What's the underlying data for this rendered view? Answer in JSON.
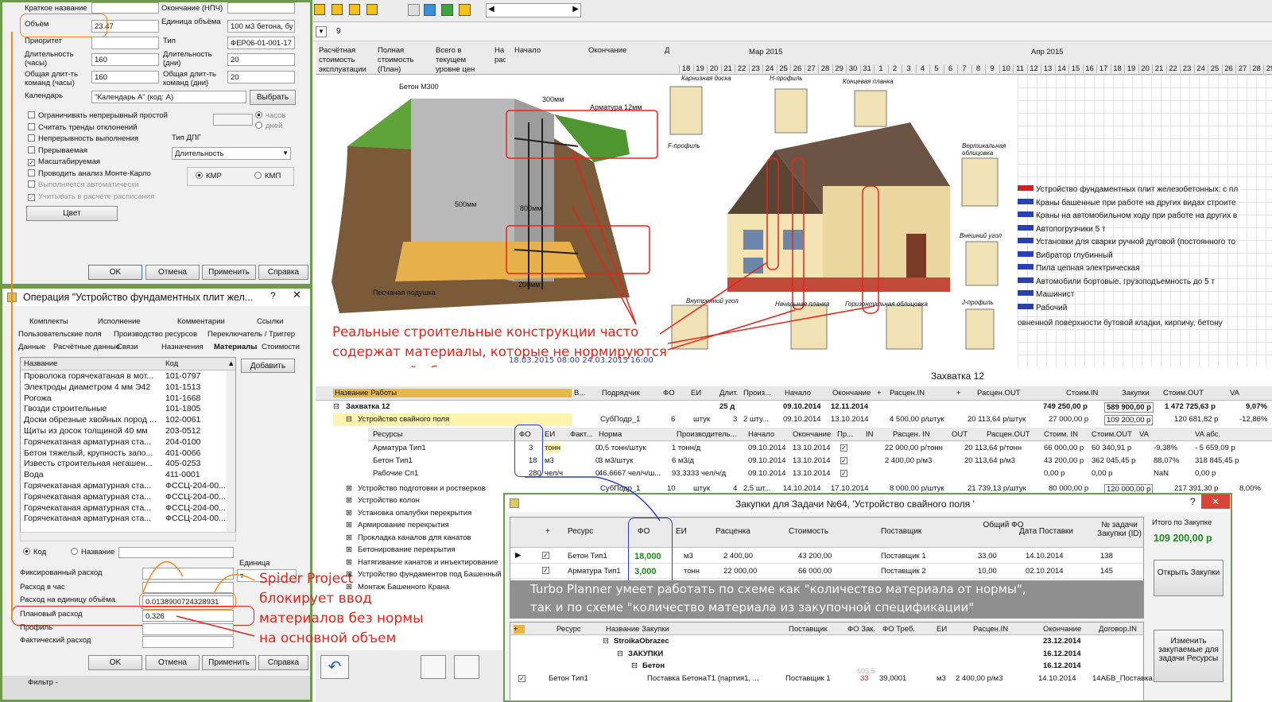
{
  "toolbar": {
    "zoom_text": "9"
  },
  "props_dialog": {
    "fields": {
      "short_name_label": "Краткое название",
      "end_label": "Окончание (НПЧ)",
      "volume_label": "Объём",
      "volume_value": "23.47",
      "unit_label": "Единица объёма",
      "unit_value": "100 м3 бетона, бу",
      "priority_label": "Приоритет",
      "type_label": "Тип",
      "type_value": "ФЕР06-01-001-17",
      "duration_label": "Длительность (часы)",
      "duration_value": "160",
      "duration_days_label": "Длительность (дни)",
      "duration_days_value": "20",
      "total_team_hours_label": "Общая длит-ть команд (часы)",
      "total_team_hours_value": "160",
      "total_team_days_label": "Общая длит-ть команд (дни)",
      "total_team_days_value": "20",
      "calendar_label": "Календарь",
      "calendar_value": "\"Календарь А\" (код: А)",
      "choose_button": "Выбрать",
      "hours_radio": "часов",
      "days_radio": "дней",
      "dpg_type_label": "Тип ДПГ",
      "dpg_type_value": "Длительность",
      "kmr": "КМР",
      "kmp": "КМП",
      "color_button": "Цвет"
    },
    "checks": [
      {
        "label": "Ограничивать непрерывный простой",
        "checked": false
      },
      {
        "label": "Считать тренды отклонений",
        "checked": false
      },
      {
        "label": "Непрерывность выполнения",
        "checked": false
      },
      {
        "label": "Прерываемая",
        "checked": false
      },
      {
        "label": "Масштабируемая",
        "checked": true
      },
      {
        "label": "Проводить анализ Монте-Карло",
        "checked": false
      },
      {
        "label": "Выполняется автоматически",
        "checked": false
      },
      {
        "label": "Учитывать в расчёте расписания",
        "checked": true
      }
    ],
    "buttons": {
      "ok": "OK",
      "cancel": "Отмена",
      "apply": "Применить",
      "help": "Справка"
    }
  },
  "op_dialog": {
    "title": "Операция \"Устройство фундаментных плит жел...",
    "tabs_row1": [
      "Комплекты",
      "Исполнение",
      "Комментарии",
      "Ссылки"
    ],
    "tabs_row2": [
      "Пользовательские поля",
      "Производство ресурсов",
      "Переключатель / Триггер"
    ],
    "tabs_row3": [
      "Данные",
      "Расчётные данные",
      "Связи",
      "Назначения",
      "Материалы",
      "Стоимости"
    ],
    "col_name": "Название",
    "col_code": "Код",
    "add_button": "Добавить",
    "materials": [
      {
        "name": "Проволока горячекатаная в мот...",
        "code": "101-0797"
      },
      {
        "name": "Электроды диаметром 4 мм Э42",
        "code": "101-1513"
      },
      {
        "name": "Рогожа",
        "code": "101-1668"
      },
      {
        "name": "Гвозди строительные",
        "code": "101-1805"
      },
      {
        "name": "Доски обрезные хвойных пород ...",
        "code": "102-0061"
      },
      {
        "name": "Щиты из досок толщиной 40 мм",
        "code": "203-0512"
      },
      {
        "name": "Горячекатаная арматурная ста...",
        "code": "204-0100"
      },
      {
        "name": "Бетон тяжелый, крупность запо...",
        "code": "401-0066"
      },
      {
        "name": "Известь строительная негашен...",
        "code": "405-0253"
      },
      {
        "name": "Вода",
        "code": "411-0001"
      },
      {
        "name": "Горячекатаная арматурная ста...",
        "code": "ФССЦ-204-00..."
      },
      {
        "name": "Горячекатаная арматурная ста...",
        "code": "ФССЦ-204-00..."
      },
      {
        "name": "Горячекатаная арматурная ста...",
        "code": "ФССЦ-204-00..."
      },
      {
        "name": "Горячекатаная арматурная ста...",
        "code": "ФССЦ-204-00..."
      }
    ],
    "radio_code": "Код",
    "radio_name": "Название",
    "unit_label": "Единица",
    "unit_value": "т",
    "fixed_label": "Фиксированный расход",
    "hourly_label": "Расход в час",
    "per_unit_label": "Расход на единицу объёма",
    "per_unit_value": "0.0138900724328931",
    "plan_label": "Плановый расход",
    "plan_value": "0.326",
    "profile_label": "Профиль",
    "actual_label": "Фактический расход",
    "buttons": {
      "ok": "OK",
      "cancel": "Отмена",
      "apply": "Применить",
      "help": "Справка"
    },
    "filter_label": "Фильтр -"
  },
  "gantt": {
    "cols": [
      "Расчётная стоимость эксплуатации",
      "Полная стоимость (План)",
      "Всего в текущем уровне цен",
      "На рас",
      "Начало",
      "Окончание",
      "Д"
    ],
    "month1": "Мар 2015",
    "month2": "Апр 2015",
    "days_mar": [
      "18",
      "19",
      "20",
      "21",
      "22",
      "23",
      "24",
      "25",
      "26",
      "27",
      "28",
      "29",
      "30",
      "31"
    ],
    "days_apr": [
      "1",
      "2",
      "3",
      "4",
      "5",
      "6",
      "7",
      "8",
      "9",
      "10",
      "11",
      "12",
      "13",
      "14",
      "15",
      "16",
      "17",
      "18",
      "19",
      "20",
      "21",
      "22",
      "23",
      "24",
      "25",
      "26",
      "27",
      "28",
      "29",
      "30"
    ],
    "resources": [
      "Устройство фундаментных плит железобетонных: с пл",
      "Краны башенные при работе на других видах строите",
      "Краны на автомобильном ходу при работе на других в",
      "Автопогрузчики 5 т",
      "Установки для сварки ручной дуговой (постоянного то",
      "Вибратор глубинный",
      "Пила цепная электрическая",
      "Автомобили бортовые, грузоподъемность до 5 т",
      "Машинист",
      "Рабочий"
    ],
    "res_tail": "овненной поверхности бутовой кладки, кирпичу, бетону",
    "date_fragment": "18.03.2015 08:00   24.03.2015 16:00"
  },
  "illustration": {
    "beton": "Бетон М300",
    "armatura": "Арматура 12мм",
    "d300": "300мм",
    "d500": "500мм",
    "d800": "800мм",
    "d200": "200мм",
    "sand": "Песчаная подушка",
    "karniz": "Карнизная доска",
    "hprof": "Н-профиль",
    "konc": "Концевая планка",
    "fprof": "F-профиль",
    "vert": "Вертикальная облицовка",
    "vnesh": "Внешний угол",
    "vnutr": "Внутренний угол",
    "nach": "Начальная планка",
    "gor": "Горизонтальная облицовка",
    "jprof": "J-профиль"
  },
  "annotations": {
    "top": [
      "Реальные строительные конструкции часто",
      "содержат материалы, которые не нормируются",
      "на основной объем операции"
    ],
    "left": [
      "Spider Project",
      "блокирует ввод",
      "материалов без нормы",
      "на основной объем"
    ],
    "bottom": [
      "Turbo Planner умеет работать по схеме как \"количество материала от нормы\",",
      "так и по схеме \"количество материала из закупочной спецификации\""
    ]
  },
  "works": {
    "title": "Захватка 12",
    "headers": [
      "Название Работы",
      "В...",
      "Подрядчик",
      "ФО",
      "ЕИ",
      "Длит.",
      "Произ...",
      "Начало",
      "Окончание",
      "+",
      "Расцен.IN",
      "+",
      "Расцен.OUT",
      "Стоим.IN",
      "Закупки",
      "Стоим.OUT",
      "VA"
    ],
    "group_row": {
      "name": "Захватка 12",
      "dur": "25 д",
      "start": "09.10.2014",
      "end": "12.11.2014",
      "cost_in": "749 250,00 р",
      "purch": "589 900,00 р",
      "cost_out": "1 472 725,63 р",
      "va": "9,07%"
    },
    "task_row": {
      "name": "Устройство свайного поля",
      "contractor": "СубПодр_1",
      "fo": "6",
      "unit": "штук",
      "dur": "3",
      "prod": "2 шту...",
      "start": "09.10.2014",
      "end": "13.10.2014",
      "rate_in": "4 500,00 р/штук",
      "rate_out": "20 113,64 р/штук",
      "cost_in": "27 000,00 р",
      "purch": "109 200,00 р",
      "cost_out": "120 681,82 р",
      "va": "-12,86%"
    },
    "sub_headers": [
      "Ресурсы",
      "ФО",
      "ЕИ",
      "Факт...",
      "Норма",
      "Производитель...",
      "Начало",
      "Окончание",
      "Пр...",
      "IN",
      "Расцен. IN",
      "OUT",
      "Расцен.OUT",
      "Стоим. IN",
      "Стоим.OUT",
      "VA",
      "VA абс."
    ],
    "sub_rows": [
      {
        "res": "Арматура Тип1",
        "fo": "3",
        "unit": "тонн",
        "fact": "0",
        "norm": "0,5 тонн/штук",
        "prod": "1 тонн/д",
        "start": "09.10.2014",
        "end": "13.10.2014",
        "rin": "22 000,00 р/тонн",
        "rout": "20 113,64 р/тонн",
        "cin": "66 000,00 р",
        "cout": "60 340,91 р",
        "va": "-9,38%",
        "vaabs": "- 5 659,09 р"
      },
      {
        "res": "Бетон Тип1",
        "fo": "18",
        "unit": "м3",
        "fact": "0",
        "norm": "3 м3/штук",
        "prod": "6 м3/д",
        "start": "09.10.2014",
        "end": "13.10.2014",
        "rin": "2 400,00 р/м3",
        "rout": "20 113,64 р/м3",
        "cin": "43 200,00 р",
        "cout": "362 045,45 р",
        "va": "88,07%",
        "vaabs": "318 845,45 р"
      },
      {
        "res": "Рабочие Сп1",
        "fo": "280",
        "unit": "чел/ч",
        "fact": "0",
        "norm": "46,6667 чел/ч/ш...",
        "prod": "93,3333 чел/ч/д",
        "start": "09.10.2014",
        "end": "13.10.2014",
        "rin": "",
        "rout": "",
        "cin": "0,00 р",
        "cout": "0,00 р",
        "va": "NaN",
        "vaabs": "0,00 р"
      }
    ],
    "tree": [
      "Устройство подготовки и ростверков",
      "Устройство колон",
      "Установка опалубки перекрытия",
      "Армирование перекрытия",
      "Прокладка каналов для канатов",
      "Бетонирование перекрытия",
      "Натягивание канатов и инъектирование",
      "Устройство фундаментов под Башенный",
      "Монтаж Башенного Крана"
    ],
    "row2": {
      "contractor": "СубПодр_1",
      "fo": "10",
      "unit": "штук",
      "dur": "4",
      "prod": "2,5 шт...",
      "start": "14.10.2014",
      "end": "17.10.2014",
      "rin": "8 000,00 р/штук",
      "rout": "21 739,13 р/штук",
      "cin": "80 000,00 р",
      "purch": "120 000,00 р",
      "cout": "217 391,30 р",
      "va": "8,00%"
    }
  },
  "purchase": {
    "title": "Закупки для Задачи №64, 'Устройство свайного поля '",
    "headers": [
      "+",
      "Ресурс",
      "ФО",
      "ЕИ",
      "Расценка",
      "Стоимость",
      "Поставщик",
      "Общий ФО",
      "Дата Поставки",
      "№ задачи Закупки (ID)"
    ],
    "rows": [
      {
        "res": "Бетон Тип1",
        "fo": "18,000",
        "unit": "м3",
        "rate": "2 400,00",
        "cost": "43 200,00",
        "supplier": "Поставщик 1",
        "total": "33,00",
        "date": "14.10.2014",
        "id": "138"
      },
      {
        "res": "Арматура Тип1",
        "fo": "3,000",
        "unit": "тонн",
        "rate": "22 000,00",
        "cost": "66 000,00",
        "supplier": "Поставщик 2",
        "total": "10,00",
        "date": "02.10.2014",
        "id": "145"
      }
    ],
    "total_label": "Итого по Закупке",
    "total_value": "109 200,00 р",
    "open_button": "Открыть Закупки",
    "change_button": "Изменить закупаемые для задачи Ресурсы",
    "lower_headers": [
      "+",
      "Ресурс",
      "Название Закупки",
      "Поставщик",
      "ФО Зак.",
      "ФО Треб.",
      "ЕИ",
      "Расцен.IN",
      "Окончание",
      "Договор.IN"
    ],
    "lower_rows": [
      {
        "name": "StroikaObrazec",
        "end": "23.12.2014"
      },
      {
        "name": "ЗАКУПКИ",
        "end": "16.12.2014"
      },
      {
        "name": "Бетон",
        "end": "16.12.2014"
      }
    ],
    "last_row": {
      "res": "Бетон Тип1",
      "name": "Поставка БетонаТ1 (партия1, ...",
      "supplier": "Поставщик 1",
      "fo": "33",
      "fotr": "39,0001",
      "unit": "м3",
      "rate": "2 400,00 р/м3",
      "end": "14.10.2014",
      "doc": "14АБВ_Поставка"
    },
    "faded": "603,5"
  }
}
